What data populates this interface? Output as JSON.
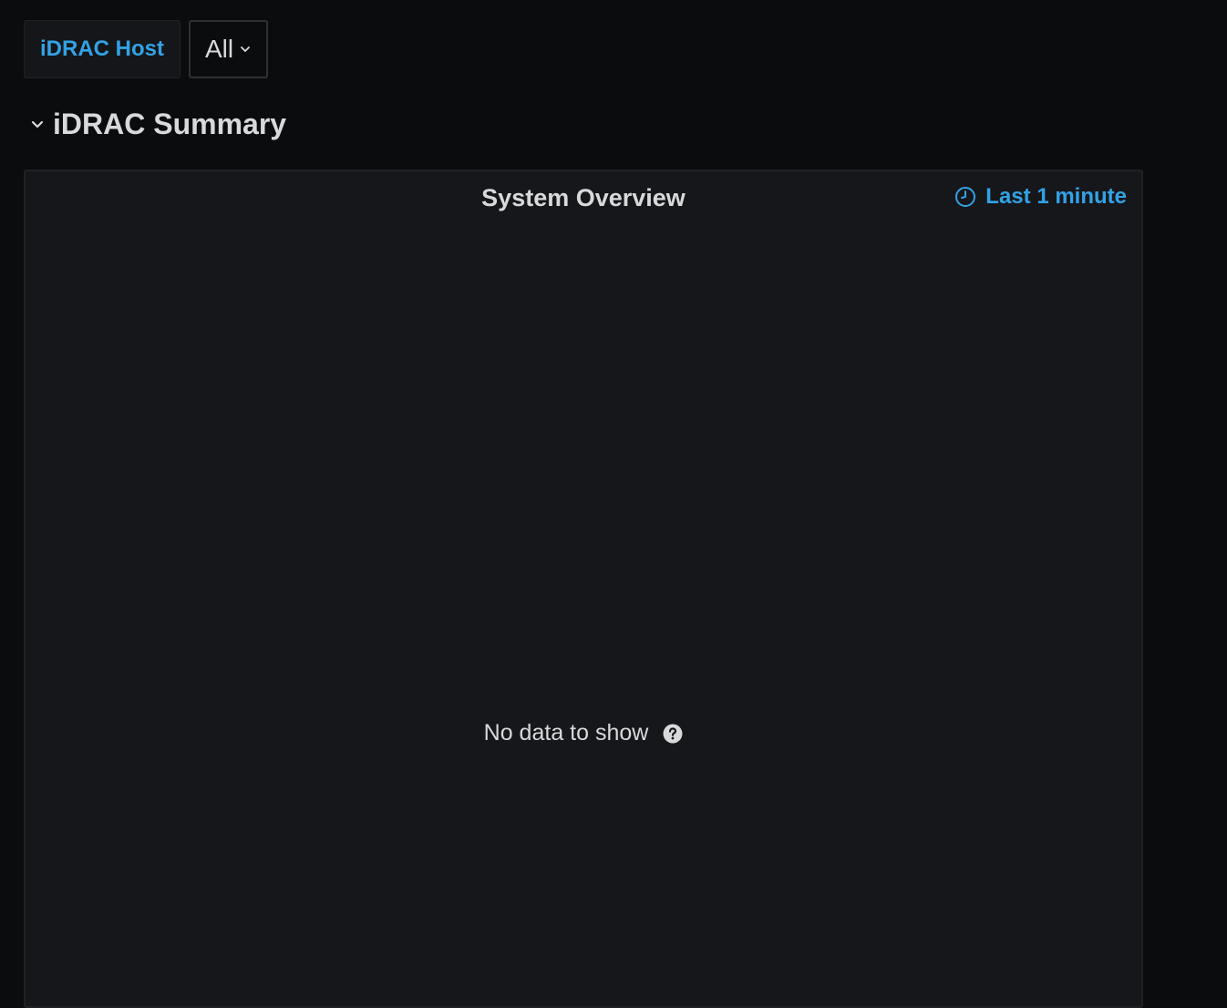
{
  "variables": {
    "host_label": "iDRAC Host",
    "host_value": "All"
  },
  "row": {
    "title": "iDRAC Summary",
    "collapse_icon": "chevron-down-icon"
  },
  "panel": {
    "title": "System Overview",
    "time_range": "Last 1 minute",
    "time_icon": "clock-icon",
    "no_data_text": "No data to show",
    "help_icon": "question-circle-icon"
  },
  "colors": {
    "accent": "#33a2e5",
    "background": "#0b0c0e",
    "panel_background": "#16171b",
    "text": "#d8d9da"
  }
}
